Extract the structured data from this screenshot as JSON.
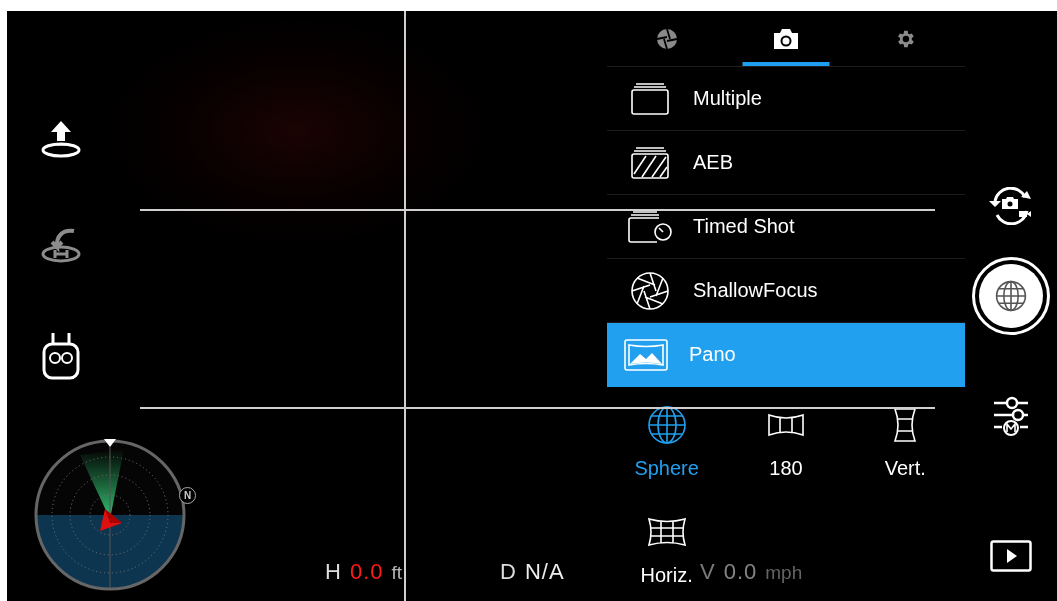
{
  "left_tools": [
    {
      "kind": "takeoff",
      "disabled": false
    },
    {
      "kind": "return-home",
      "disabled": true
    },
    {
      "kind": "remote",
      "disabled": false
    }
  ],
  "radar": {
    "north_label": "N"
  },
  "camera_panel": {
    "tabs": [
      {
        "kind": "aperture",
        "selected": false
      },
      {
        "kind": "camera",
        "selected": true
      },
      {
        "kind": "gear",
        "selected": false
      }
    ],
    "modes": [
      {
        "label": "Multiple",
        "kind": "multiple",
        "selected": false
      },
      {
        "label": "AEB",
        "kind": "aeb",
        "selected": false
      },
      {
        "label": "Timed Shot",
        "kind": "timed",
        "selected": false
      },
      {
        "label": "ShallowFocus",
        "kind": "shallow",
        "selected": false
      },
      {
        "label": "Pano",
        "kind": "pano",
        "selected": true
      }
    ],
    "pano_options": [
      {
        "label": "Sphere",
        "kind": "sphere",
        "selected": true
      },
      {
        "label": "180",
        "kind": "wide",
        "selected": false
      },
      {
        "label": "Vert.",
        "kind": "vertical",
        "selected": false
      },
      {
        "label": "Horiz.",
        "kind": "horizontal",
        "selected": false
      }
    ]
  },
  "telemetry": [
    {
      "label": "H",
      "value": "0.0",
      "unit": "ft",
      "alert": true,
      "dimmed": false
    },
    {
      "label": "D",
      "value": "N/A",
      "alert": false,
      "dimmed": false
    },
    {
      "label": "V",
      "value": "0.0",
      "unit": "mph",
      "alert": false,
      "dimmed": true
    }
  ],
  "right_tools": [
    {
      "kind": "switch-mode"
    },
    {
      "kind": "shutter"
    },
    {
      "kind": "settings"
    },
    {
      "kind": "playback"
    }
  ]
}
